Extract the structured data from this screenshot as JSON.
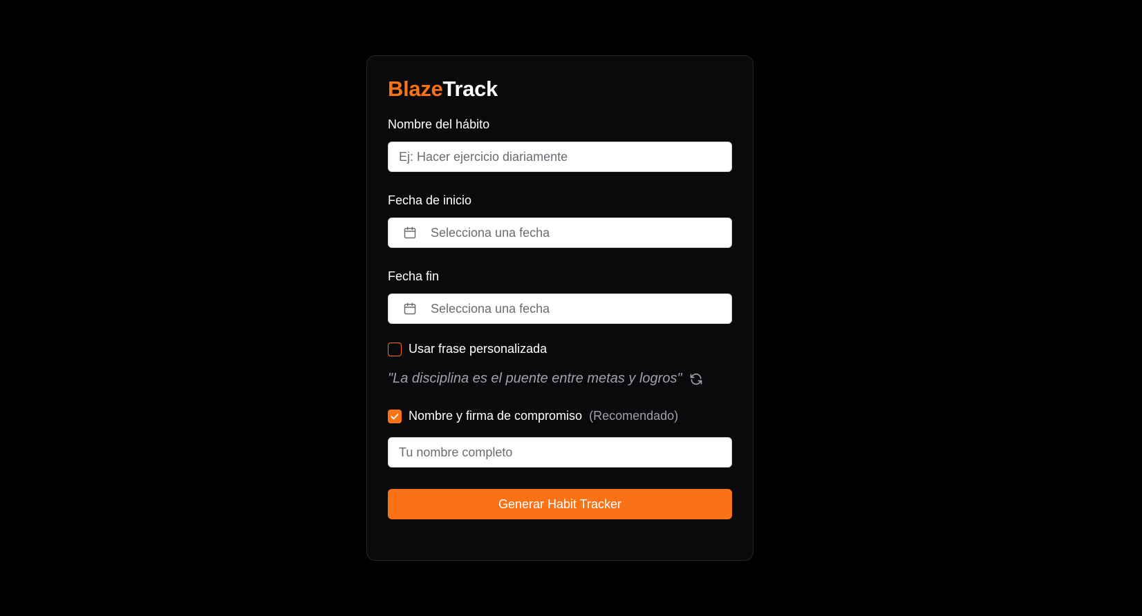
{
  "logo": {
    "accent": "Blaze",
    "rest": "Track"
  },
  "habit": {
    "label": "Nombre del hábito",
    "placeholder": "Ej: Hacer ejercicio diariamente"
  },
  "start_date": {
    "label": "Fecha de inicio",
    "placeholder": "Selecciona una fecha",
    "icon": "calendar-icon"
  },
  "end_date": {
    "label": "Fecha fin",
    "placeholder": "Selecciona una fecha",
    "icon": "calendar-icon"
  },
  "custom_phrase": {
    "label": "Usar frase personalizada",
    "checked": false
  },
  "quote": {
    "text": "\"La disciplina es el puente entre metas y logros\"",
    "icon": "refresh-icon"
  },
  "signature": {
    "label": "Nombre y firma de compromiso",
    "note": "(Recomendado)",
    "checked": true,
    "placeholder": "Tu nombre completo"
  },
  "submit": {
    "label": "Generar Habit Tracker"
  },
  "colors": {
    "accent": "#f97316",
    "background": "#000000",
    "card": "#0a0a0c"
  }
}
